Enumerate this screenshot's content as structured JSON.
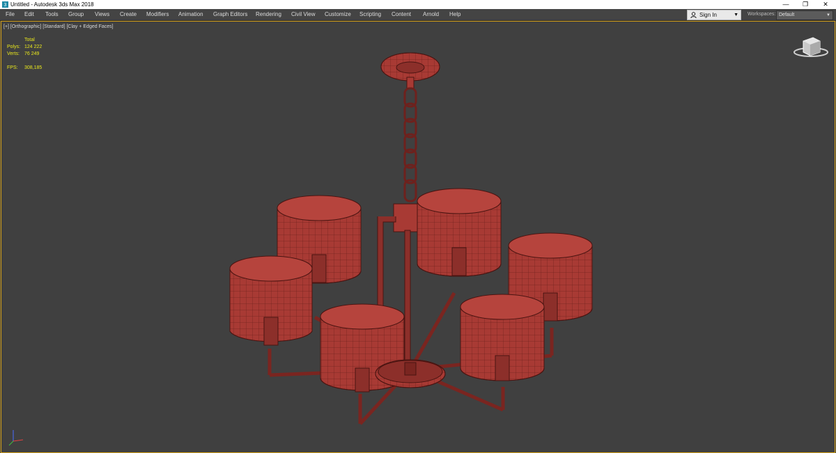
{
  "window": {
    "title": "Untitled - Autodesk 3ds Max 2018",
    "controls": [
      "—",
      "❐",
      "✕"
    ]
  },
  "menu": {
    "items": [
      "File",
      "Edit",
      "Tools",
      "Group",
      "Views",
      "Create",
      "Modifiers",
      "Animation",
      "Graph Editors",
      "Rendering",
      "Civil View",
      "Customize",
      "Scripting",
      "Content",
      "Arnold",
      "Help"
    ]
  },
  "account": {
    "sign_in": "Sign In",
    "workspaces_label": "Workspaces:",
    "workspace_value": "Default"
  },
  "viewport": {
    "label": "[+] [Orthographic] [Standard] [Clay + Edged Faces]",
    "stats": {
      "header": "Total",
      "polys_label": "Polys:",
      "polys_value": "124 222",
      "verts_label": "Verts:",
      "verts_value": "76 249",
      "fps_label": "FPS:",
      "fps_value": "308,185"
    }
  },
  "colors": {
    "viewport_bg": "#404040",
    "active_border": "#d4a017",
    "stats_text": "#e8e61c",
    "wire_fill": "#a83a34",
    "wire_edge": "#4a1411"
  }
}
